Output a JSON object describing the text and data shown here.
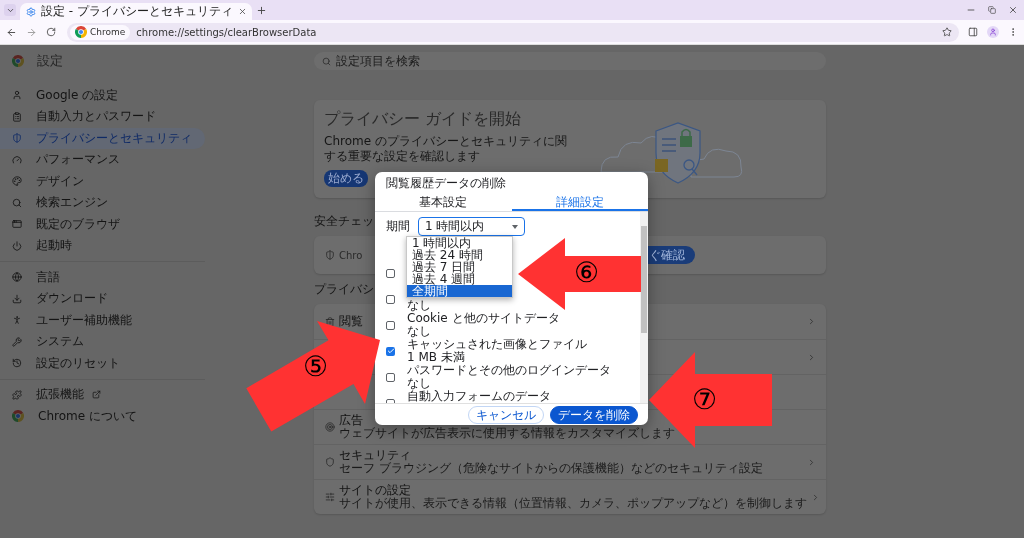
{
  "browser": {
    "tab_title": "設定 - プライバシーとセキュリティ",
    "site_chip": "Chrome",
    "url": "chrome://settings/clearBrowserData"
  },
  "sidebar": {
    "title": "設定",
    "groups": [
      {
        "items": [
          {
            "label": "Google の設定",
            "selected": false
          },
          {
            "label": "自動入力とパスワード",
            "selected": false
          },
          {
            "label": "プライバシーとセキュリティ",
            "selected": true
          },
          {
            "label": "パフォーマンス",
            "selected": false
          },
          {
            "label": "デザイン",
            "selected": false
          },
          {
            "label": "検索エンジン",
            "selected": false
          },
          {
            "label": "既定のブラウザ",
            "selected": false
          },
          {
            "label": "起動時",
            "selected": false
          }
        ]
      },
      {
        "items": [
          {
            "label": "言語",
            "selected": false
          },
          {
            "label": "ダウンロード",
            "selected": false
          },
          {
            "label": "ユーザー補助機能",
            "selected": false
          },
          {
            "label": "システム",
            "selected": false
          },
          {
            "label": "設定のリセット",
            "selected": false
          }
        ]
      },
      {
        "items": [
          {
            "label": "拡張機能",
            "selected": false,
            "kind": "external"
          },
          {
            "label": "Chrome について",
            "selected": false,
            "kind": "plain"
          }
        ]
      }
    ]
  },
  "search": {
    "placeholder": "設定項目を検索"
  },
  "privacy_guide": {
    "title": "プライバシー ガイドを開始",
    "description": "Chrome のプライバシーとセキュリティに関する重要な設定を確認します",
    "button": "始める"
  },
  "safety_check": {
    "heading": "安全チェッ",
    "text": "Chro",
    "button": "ぐ確認"
  },
  "privacy_section": {
    "heading": "プライバシ",
    "rows": [
      {
        "kind": "full",
        "title": "閲覧"
      },
      {
        "kind": "chevron"
      },
      {
        "kind": "blank"
      },
      {
        "kind": "text",
        "title": "広告",
        "description": "ウェブサイトが広告表示に使用する情報をカスタマイズします"
      },
      {
        "kind": "full",
        "title": "セキュリティ",
        "description": "セーフ ブラウジング（危険なサイトからの保護機能）などのセキュリティ設定"
      },
      {
        "kind": "full",
        "title": "サイトの設定",
        "description": "サイトが使用、表示できる情報（位置情報、カメラ、ポップアップなど）を制御します"
      }
    ]
  },
  "dialog": {
    "title": "閲覧履歴データの削除",
    "tabs": [
      {
        "label": "基本設定",
        "selected": false
      },
      {
        "label": "詳細設定",
        "selected": true
      }
    ],
    "period": {
      "label": "期間",
      "value": "1 時間以内"
    },
    "options": [
      {
        "label": "1 時間以内",
        "selected": false
      },
      {
        "label": "過去 24 時間",
        "selected": false
      },
      {
        "label": "過去 7 日間",
        "selected": false
      },
      {
        "label": "過去 4 週間",
        "selected": false
      },
      {
        "label": "全期間",
        "selected": true
      }
    ],
    "items": [
      {
        "checked": false
      },
      {
        "subtitle": "なし",
        "checked": false
      },
      {
        "title": "Cookie と他のサイトデータ",
        "subtitle": "なし",
        "checked": false
      },
      {
        "title": "キャッシュされた画像とファイル",
        "subtitle": "1 MB 未満",
        "checked": true
      },
      {
        "title": "パスワードとその他のログインデータ",
        "subtitle": "なし",
        "checked": false
      },
      {
        "title": "自動入力フォームのデータ",
        "checked": false
      }
    ],
    "buttons": [
      {
        "label": "キャンセル",
        "kind": "secondary"
      },
      {
        "label": "データを削除",
        "kind": "primary"
      }
    ]
  },
  "annotations": [
    {
      "label": "⑤"
    },
    {
      "label": "⑥"
    },
    {
      "label": "⑦"
    }
  ]
}
